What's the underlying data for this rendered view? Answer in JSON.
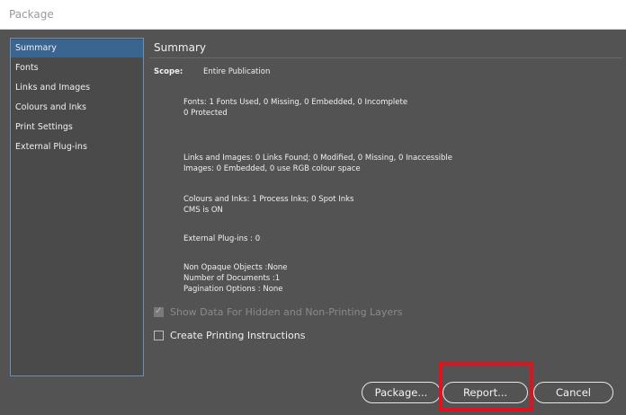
{
  "window": {
    "title": "Package"
  },
  "sidebar": {
    "items": [
      {
        "label": "Summary",
        "selected": true
      },
      {
        "label": "Fonts",
        "selected": false
      },
      {
        "label": "Links and Images",
        "selected": false
      },
      {
        "label": "Colours and Inks",
        "selected": false
      },
      {
        "label": "Print Settings",
        "selected": false
      },
      {
        "label": "External Plug-ins",
        "selected": false
      }
    ]
  },
  "main": {
    "heading": "Summary",
    "scope_label": "Scope:",
    "scope_value": "Entire Publication",
    "fonts_line1": "Fonts: 1 Fonts Used, 0 Missing, 0 Embedded, 0 Incomplete",
    "fonts_line2": "0 Protected",
    "links_line1": "Links and Images: 0 Links Found; 0 Modified, 0 Missing, 0 Inaccessible",
    "links_line2": "Images: 0 Embedded, 0 use RGB colour space",
    "colours_line1": "Colours and Inks: 1 Process Inks; 0 Spot Inks",
    "colours_line2": "CMS is ON",
    "plugins_line": "External Plug-ins : 0",
    "other_line1": "Non Opaque Objects :None",
    "other_line2": "Number of Documents :1",
    "other_line3": "Pagination Options : None",
    "show_hidden_label": "Show Data For Hidden and Non-Printing Layers",
    "show_hidden_checked": true,
    "show_hidden_disabled": true,
    "create_instructions_label": "Create Printing Instructions",
    "create_instructions_checked": false
  },
  "buttons": {
    "package": "Package...",
    "report": "Report...",
    "cancel": "Cancel"
  },
  "colors": {
    "dialog_bg": "#535353",
    "selection": "#3b6591",
    "highlight": "#e0121e"
  }
}
